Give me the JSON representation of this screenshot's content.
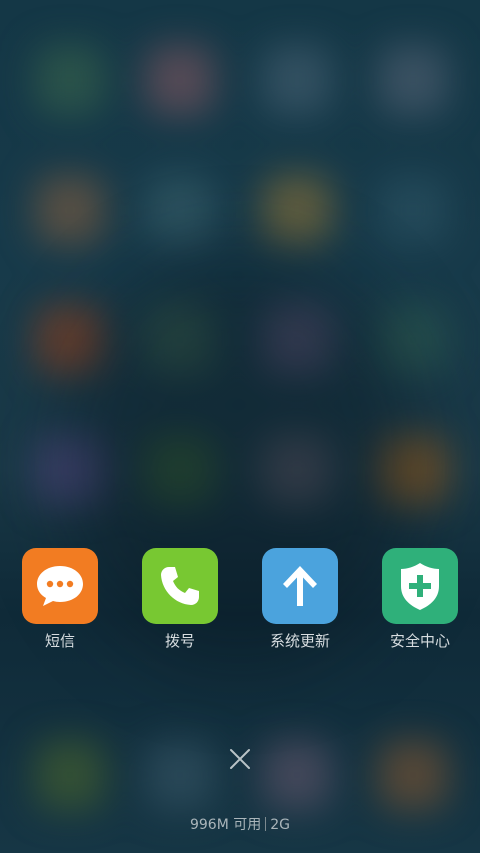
{
  "recent_apps": [
    {
      "label": "短信",
      "icon": "message-icon",
      "color": "#f27c22"
    },
    {
      "label": "拨号",
      "icon": "phone-icon",
      "color": "#78c832"
    },
    {
      "label": "系统更新",
      "icon": "arrow-up-icon",
      "color": "#4ba3dd"
    },
    {
      "label": "安全中心",
      "icon": "shield-plus-icon",
      "color": "#2fb07a"
    }
  ],
  "close": {
    "icon": "close-icon"
  },
  "memory": {
    "available": "996M 可用",
    "total": "2G"
  },
  "colors": {
    "background": "#173a4a",
    "label_text": "#d7dde0"
  }
}
